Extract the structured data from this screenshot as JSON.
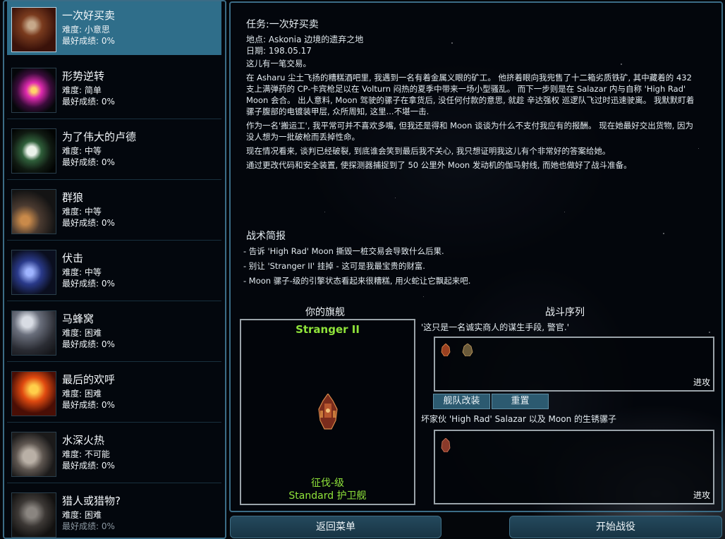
{
  "missions": [
    {
      "name": "一次好买卖",
      "difficulty": "难度: 小意思",
      "best": "最好成绩: 0%"
    },
    {
      "name": "形势逆转",
      "difficulty": "难度: 简单",
      "best": "最好成绩: 0%"
    },
    {
      "name": "为了伟大的卢德",
      "difficulty": "难度: 中等",
      "best": "最好成绩: 0%"
    },
    {
      "name": "群狼",
      "difficulty": "难度: 中等",
      "best": "最好成绩: 0%"
    },
    {
      "name": "伏击",
      "difficulty": "难度: 中等",
      "best": "最好成绩: 0%"
    },
    {
      "name": "马蜂窝",
      "difficulty": "难度: 困难",
      "best": "最好成绩: 0%"
    },
    {
      "name": "最后的欢呼",
      "difficulty": "难度: 困难",
      "best": "最好成绩: 0%"
    },
    {
      "name": "水深火热",
      "difficulty": "难度: 不可能",
      "best": "最好成绩: 0%"
    },
    {
      "name": "猎人或猎物?",
      "difficulty": "难度: 困难",
      "best": "最好成绩: 0%"
    }
  ],
  "briefing": {
    "title": "任务:一次好买卖",
    "location": "地点: Askonia 边境的遗弃之地",
    "date": "日期: 198.05.17",
    "paragraphs": [
      "这儿有一笔交易。",
      "在 Asharu 尘土飞扬的糟糕酒吧里, 我遇到一名有着金属义眼的矿工。 他挤着眼向我兜售了十二箱劣质铁矿, 其中藏着的 432 支上满弹药的 CP-卡宾枪足以在 Volturn 闷热的夏季中带来一场小型骚乱。 而下一步则是在 Salazar 内与自称 'High Rad' Moon 会合。 出人意料, Moon 驾驶的骡子在拿货后, 没任何付款的意思, 就趁 辛达强权 巡逻队飞过时迅速驶离。 我默默盯着骡子腹部的电镀装甲层, 众所周知, 这里...不堪一击.",
      "作为一名'搬运工', 我平常可并不喜欢多嘴, 但我还是得和 Moon 谈谈为什么不支付我应有的报酬。 现在她最好交出货物, 因为没人想为一批破枪而丢掉性命。",
      "现在情况看来, 谈判已经破裂, 到底谁会笑到最后我不关心, 我只想证明我这儿有个非常好的答案给她。",
      "通过更改代码和安全装置, 使探测器捕捉到了 50 公里外 Moon 发动机的伽马射线, 而她也做好了战斗准备。"
    ],
    "tactics_title": "战术简报",
    "tactics": [
      "- 告诉 'High Rad' Moon 撕毁一桩交易会导致什么后果.",
      "- 别让 'Stranger II' 挂掉 - 这可是我最宝贵的财富.",
      "- Moon 骡子-级的引擎状态看起来很糟糕, 用火蛇让它飘起来吧."
    ]
  },
  "flagship": {
    "label": "你的旗舰",
    "name": "Stranger II",
    "class": "征伐-级",
    "type": "Standard 护卫舰"
  },
  "battle": {
    "label": "战斗序列",
    "player_quote": "'这只是一名诚实商人的谋生手段, 警官.'",
    "enemy_quote": "坏家伙 'High Rad' Salazar 以及 Moon 的生锈骡子",
    "advance_label": "进攻",
    "refit_label": "舰队改装",
    "reset_label": "重置"
  },
  "buttons": {
    "back": "返回菜单",
    "start": "开始战役"
  },
  "colors": {
    "accent": "#3b6c86",
    "selected": "#2f6e8a",
    "ship_text": "#8fe33a"
  }
}
